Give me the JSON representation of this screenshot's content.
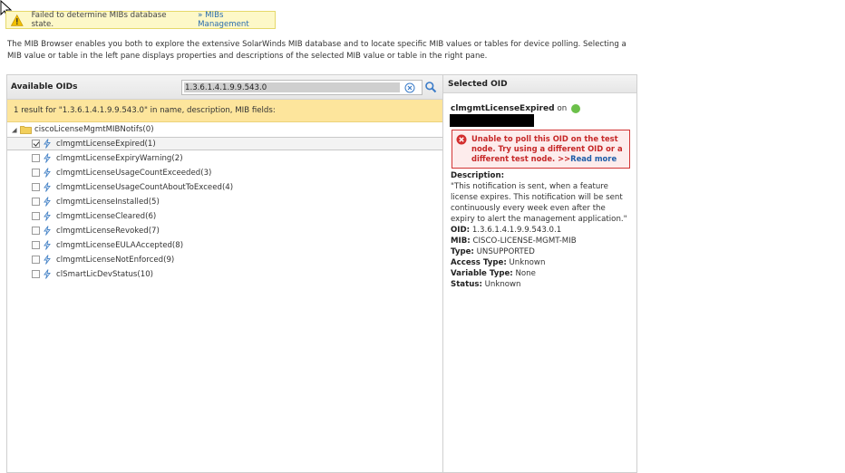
{
  "banner": {
    "message": "Failed to determine MIBs database state.",
    "link": "» MIBs Management"
  },
  "intro": "The MIB Browser enables you both to explore the extensive SolarWinds MIB database and to locate specific MIB values or tables for device polling. Selecting a MIB value or table in the left pane displays properties and descriptions of the selected MIB value or table in the right pane.",
  "left": {
    "title": "Available OIDs",
    "search_value": "1.3.6.1.4.1.9.9.543.0",
    "result_text": "1 result for \"1.3.6.1.4.1.9.9.543.0\" in name, description, MIB fields:",
    "root": "ciscoLicenseMgmtMIBNotifs(0)",
    "items": [
      {
        "label": "clmgmtLicenseExpired(1)",
        "checked": true
      },
      {
        "label": "clmgmtLicenseExpiryWarning(2)",
        "checked": false
      },
      {
        "label": "clmgmtLicenseUsageCountExceeded(3)",
        "checked": false
      },
      {
        "label": "clmgmtLicenseUsageCountAboutToExceed(4)",
        "checked": false
      },
      {
        "label": "clmgmtLicenseInstalled(5)",
        "checked": false
      },
      {
        "label": "clmgmtLicenseCleared(6)",
        "checked": false
      },
      {
        "label": "clmgmtLicenseRevoked(7)",
        "checked": false
      },
      {
        "label": "clmgmtLicenseEULAAccepted(8)",
        "checked": false
      },
      {
        "label": "clmgmtLicenseNotEnforced(9)",
        "checked": false
      },
      {
        "label": "clSmartLicDevStatus(10)",
        "checked": false
      }
    ]
  },
  "right": {
    "title": "Selected OID",
    "selected_name": "clmgmtLicenseExpired",
    "on_text": "on",
    "error_text": "Unable to poll this OID on the test node. Try using a different OID or a different test node. >>",
    "error_link": "Read more",
    "description_label": "Description:",
    "description": "\"This notification is sent, when a feature license expires. This notification will be sent continuously every week even after the expiry to alert the management application.\"",
    "oid_label": "OID:",
    "oid": "1.3.6.1.4.1.9.9.543.0.1",
    "mib_label": "MIB:",
    "mib": "CISCO-LICENSE-MGMT-MIB",
    "type_label": "Type:",
    "type": "UNSUPPORTED",
    "access_label": "Access Type:",
    "access": "Unknown",
    "vartype_label": "Variable Type:",
    "vartype": "None",
    "status_label": "Status:",
    "status": "Unknown"
  },
  "colors": {
    "banner_bg": "#fdf8c8",
    "result_bar_bg": "#fde59c",
    "error_red": "#c62828",
    "status_green": "#6cc04a",
    "link_blue": "#2b6dad"
  },
  "icons": [
    "warning-icon",
    "clear-search-icon",
    "search-icon",
    "folder-icon",
    "notification-bolt-icon",
    "error-icon",
    "status-up-icon"
  ]
}
